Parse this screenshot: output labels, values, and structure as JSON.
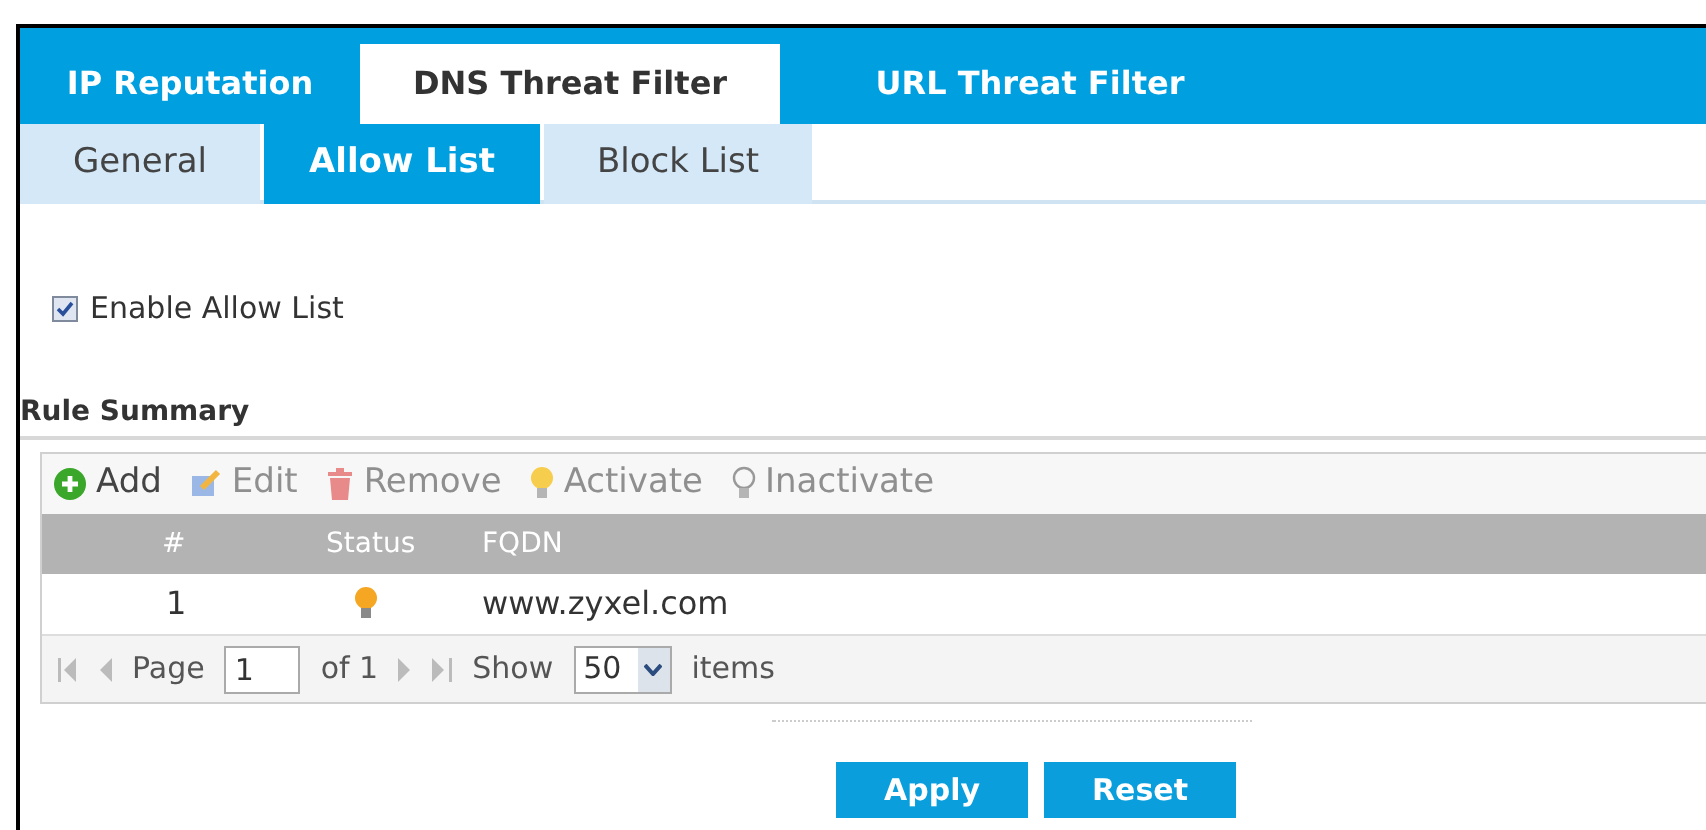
{
  "tabs": [
    {
      "label": "IP Reputation",
      "selected": false
    },
    {
      "label": "DNS Threat Filter",
      "selected": true
    },
    {
      "label": "URL Threat Filter",
      "selected": false
    }
  ],
  "subtabs": [
    {
      "label": "General",
      "selected": false
    },
    {
      "label": "Allow List",
      "selected": true
    },
    {
      "label": "Block List",
      "selected": false
    }
  ],
  "enable": {
    "label": "Enable Allow List",
    "checked": true
  },
  "section_title": "Rule Summary",
  "toolbar": [
    {
      "kind": "add",
      "label": "Add",
      "disabled": false
    },
    {
      "kind": "edit",
      "label": "Edit",
      "disabled": true
    },
    {
      "kind": "remove",
      "label": "Remove",
      "disabled": true
    },
    {
      "kind": "activate",
      "label": "Activate",
      "disabled": true
    },
    {
      "kind": "inactivate",
      "label": "Inactivate",
      "disabled": true
    }
  ],
  "table": {
    "columns": [
      "#",
      "Status",
      "FQDN"
    ],
    "rows": [
      {
        "index": "1",
        "active": true,
        "fqdn": "www.zyxel.com"
      }
    ]
  },
  "pager": {
    "page_label": "Page",
    "page": "1",
    "of": "of 1",
    "show_label": "Show",
    "per_page": "50",
    "items_label": "items"
  },
  "buttons": [
    "Apply",
    "Reset"
  ]
}
